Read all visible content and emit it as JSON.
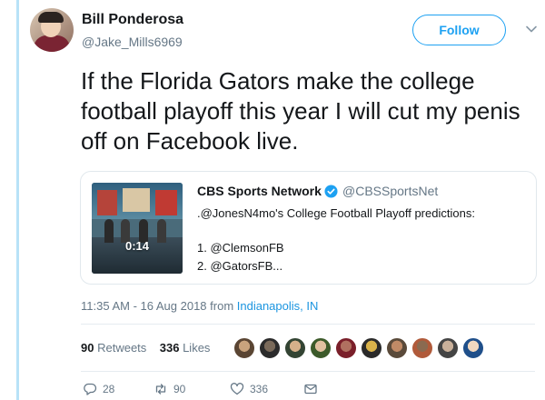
{
  "author": {
    "name": "Bill Ponderosa",
    "handle": "@Jake_Mills6969"
  },
  "follow_label": "Follow",
  "tweet_text": "If the Florida Gators make the college football playoff this year I will cut my penis off on Facebook live.",
  "quoted": {
    "name": "CBS Sports Network",
    "handle": "@CBSSportsNet",
    "video_duration": "0:14",
    "lines": [
      ".@JonesN4mo's College Football Playoff predictions:",
      "1. @ClemsonFB",
      "2. @GatorsFB..."
    ]
  },
  "timestamp": {
    "time": "11:35 AM - 16 Aug 2018 from ",
    "location": "Indianapolis, IN"
  },
  "stats": {
    "retweets_count": "90",
    "retweets_label": "Retweets",
    "likes_count": "336",
    "likes_label": "Likes"
  },
  "actions": {
    "replies": "28",
    "retweets": "90",
    "likes": "336"
  },
  "colors": {
    "accent": "#1da1f2",
    "link": "#1b95e0",
    "muted": "#657786"
  }
}
